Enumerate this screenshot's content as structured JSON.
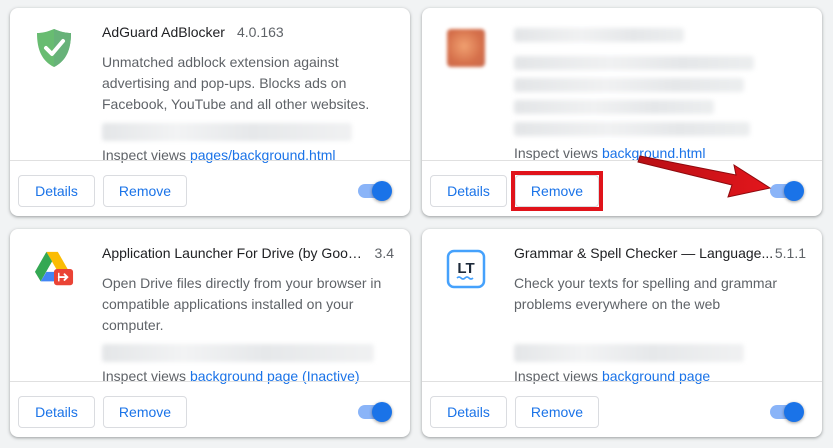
{
  "common": {
    "details_label": "Details",
    "remove_label": "Remove",
    "inspect_prefix": "Inspect views "
  },
  "extensions": [
    {
      "name": "AdGuard AdBlocker",
      "version": "4.0.163",
      "description": "Unmatched adblock extension against advertising and pop-ups. Blocks ads on Facebook, YouTube and all other websites.",
      "inspect_link": "pages/background.html",
      "icon": "adguard-shield-icon",
      "enabled": true
    },
    {
      "name": "",
      "version": "",
      "description": "",
      "inspect_link": "background.html",
      "icon": "blurred-extension-icon",
      "enabled": true
    },
    {
      "name": "Application Launcher For Drive (by Googl...",
      "version": "3.4",
      "description": "Open Drive files directly from your browser in compatible applications installed on your computer.",
      "inspect_link": "background page (Inactive)",
      "icon": "drive-launcher-icon",
      "enabled": true
    },
    {
      "name": "Grammar & Spell Checker — Language...",
      "version": "5.1.1",
      "description": "Check your texts for spelling and grammar problems everywhere on the web",
      "inspect_link": "background page",
      "icon": "languagetool-icon",
      "enabled": true
    }
  ],
  "colors": {
    "accent": "#1a73e8",
    "toggle_track": "#8ab4f8",
    "annotation_red": "#e0131a"
  }
}
